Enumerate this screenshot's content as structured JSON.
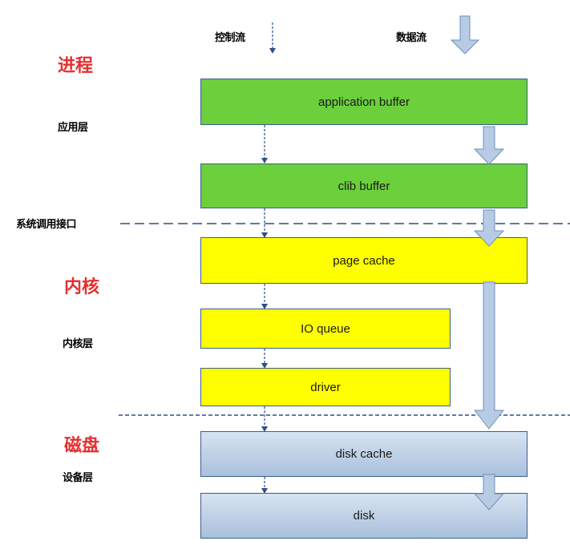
{
  "header": {
    "control_flow": "控制流",
    "data_flow": "数据流"
  },
  "sections": {
    "process": "进程",
    "kernel": "内核",
    "disk": "磁盘"
  },
  "layers": {
    "app_layer": "应用层",
    "syscall": "系统调用接口",
    "kernel_layer": "内核层",
    "device_layer": "设备层"
  },
  "boxes": {
    "application_buffer": "application buffer",
    "clib_buffer": "clib buffer",
    "page_cache": "page cache",
    "io_queue": "IO queue",
    "driver": "driver",
    "disk_cache": "disk cache",
    "disk": "disk"
  },
  "colors": {
    "process_boxes": "#6ccf3c",
    "kernel_boxes": "#ffff00",
    "device_boxes": "#b9cde6",
    "section_label": "#e53030",
    "arrow": "#a9c0dc"
  }
}
